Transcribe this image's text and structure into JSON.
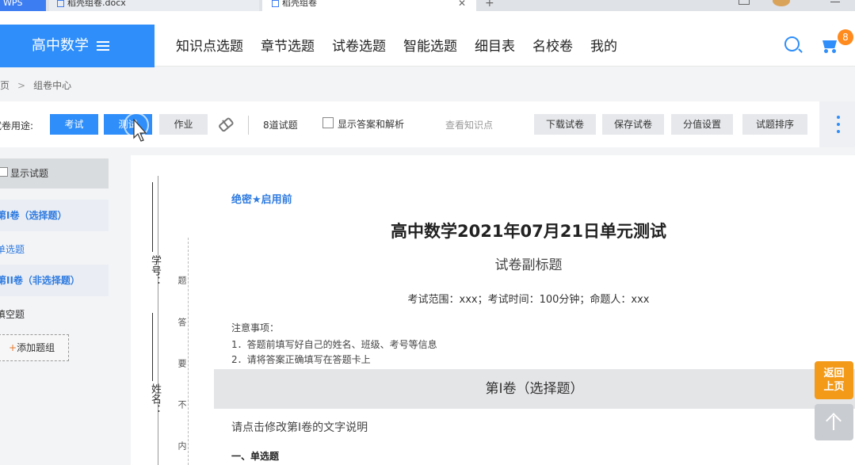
{
  "tabs": {
    "wps": "WPS",
    "doc": "稻壳组卷.docx",
    "active": "稻壳组卷"
  },
  "header": {
    "brand": "高中数学",
    "nav": [
      "知识点选题",
      "章节选题",
      "试卷选题",
      "智能选题",
      "细目表",
      "名校卷",
      "我的"
    ],
    "cart_count": "8"
  },
  "breadcrumb": {
    "home": "首页",
    "sep": ">",
    "current": "组卷中心"
  },
  "toolbar": {
    "usage_label": "试卷用途:",
    "exam": "考试",
    "test": "测试",
    "homework": "作业",
    "question_count": "8道试题",
    "show_answers": "显示答案和解析",
    "view_knowledge": "查看知识点",
    "download": "下载试卷",
    "save": "保存试卷",
    "score_settings": "分值设置",
    "sort": "试题排序"
  },
  "sidebar": {
    "show_questions": "显示试题",
    "part1": "第I卷（选择题）",
    "item1": "单选题",
    "part2": "第II卷（非选择题）",
    "item2": "填空题",
    "add_group": "添加题组",
    "add_plus": "+"
  },
  "paper": {
    "margin_labels": {
      "student_no": "学号：",
      "name": "姓名：",
      "chars": [
        "题",
        "答",
        "要",
        "不",
        "内"
      ]
    },
    "secret": "绝密★启用前",
    "title": "高中数学2021年07月21日单元测试",
    "subtitle": "试卷副标题",
    "info": "考试范围：xxx；考试时间：100分钟；命题人：xxx",
    "notes_heading": "注意事项：",
    "notes": [
      "1．答题前填写好自己的姓名、班级、考号等信息",
      "2．请将答案正确填写在答题卡上"
    ],
    "part1_title": "第I卷（选择题）",
    "part1_desc": "请点击修改第I卷的文字说明",
    "section1": "一、单选题"
  },
  "float": {
    "back_line1": "返回",
    "back_line2": "上页"
  },
  "colors": {
    "accent": "#2f8ef9",
    "orange": "#f39a19"
  }
}
